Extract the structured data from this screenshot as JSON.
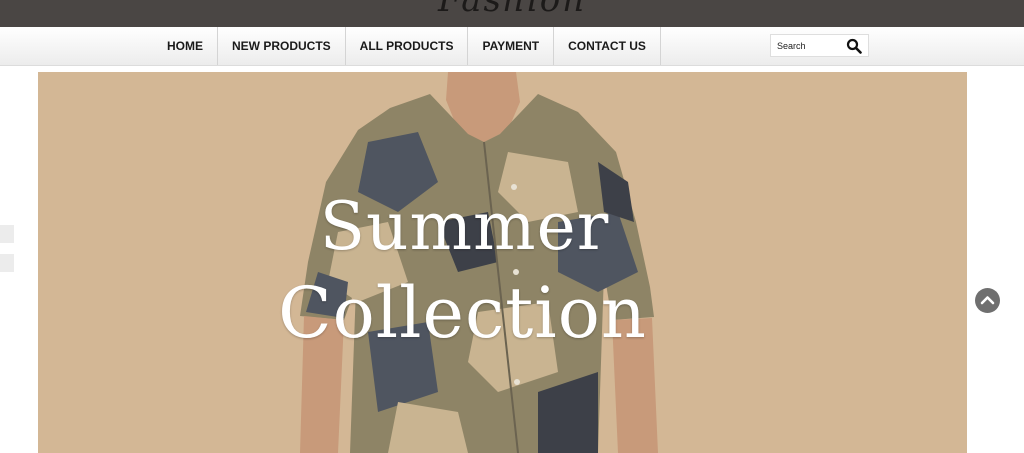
{
  "brand": {
    "logo_text": "Fashion"
  },
  "nav": {
    "items": [
      "HOME",
      "NEW PRODUCTS",
      "ALL PRODUCTS",
      "PAYMENT",
      "CONTACT US"
    ]
  },
  "search": {
    "placeholder": "Search",
    "icon": "search-icon"
  },
  "banner": {
    "line1": "Summer",
    "line2": "Collection",
    "background_color": "#d3b795"
  },
  "scroll_top": {
    "icon": "chevron-up-icon"
  },
  "colors": {
    "topbar": "#4a4644",
    "nav_text": "#1a1a1a"
  }
}
